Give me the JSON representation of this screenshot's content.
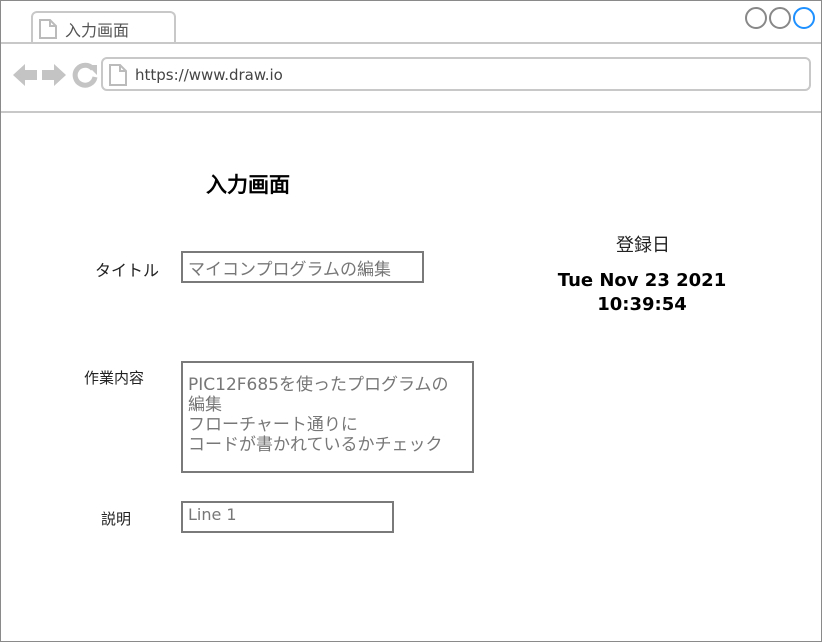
{
  "browser": {
    "tab_title": "入力画面",
    "url": "https://www.draw.io",
    "icons": [
      "page-icon",
      "back-arrow-icon",
      "forward-arrow-icon",
      "reload-icon"
    ]
  },
  "form": {
    "heading": "入力画面",
    "title_label": "タイトル",
    "title_value": "マイコンプログラムの編集",
    "content_label": "作業内容",
    "content_value": "PIC12F685を使ったプログラムの\n編集\nフローチャート通りに\nコードが書かれているかチェック",
    "description_label": "説明",
    "description_value": "Line 1"
  },
  "registration": {
    "label": "登録日",
    "date_line1": "Tue Nov 23 2021",
    "date_line2": "10:39:54"
  },
  "colors": {
    "accent_circle": "#1e90ff",
    "chrome_gray": "#c8c8c8"
  }
}
